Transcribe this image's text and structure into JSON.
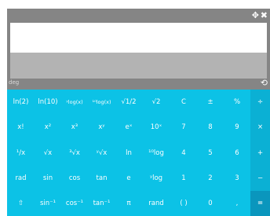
{
  "window": {
    "move_icon": "move-icon",
    "close_icon": "close-icon",
    "move_glyph": "✥",
    "close_glyph": "✖"
  },
  "display": {
    "main_value": "",
    "expression": ""
  },
  "mode": {
    "label": "deg",
    "undo_glyph": "⟲",
    "undo_icon": "undo-icon"
  },
  "colors": {
    "frame": "#858585",
    "keypad": "#0cc2e6",
    "operator_column": "#0bb0d4",
    "equals": "#0a96bd",
    "secondary_display": "#b3b3b3"
  },
  "keys": [
    [
      "ln(2)",
      "ln(10)",
      "ʸlog(x)",
      "¹⁰log(x)",
      "√1/2",
      "√2",
      "C",
      "±",
      "%",
      "÷"
    ],
    [
      "x!",
      "x²",
      "x³",
      "xʸ",
      "eˣ",
      "10ˣ",
      "7",
      "8",
      "9",
      "×"
    ],
    [
      "¹/x",
      "√x",
      "³√x",
      "ʸ√x",
      "ln",
      "¹⁰log",
      "4",
      "5",
      "6",
      "+"
    ],
    [
      "rad",
      "sin",
      "cos",
      "tan",
      "e",
      "ʸlog",
      "1",
      "2",
      "3",
      "−"
    ],
    [
      "⇧",
      "sin⁻¹",
      "cos⁻¹",
      "tan⁻¹",
      "π",
      "rand",
      "( )",
      "0",
      ",",
      "="
    ]
  ]
}
